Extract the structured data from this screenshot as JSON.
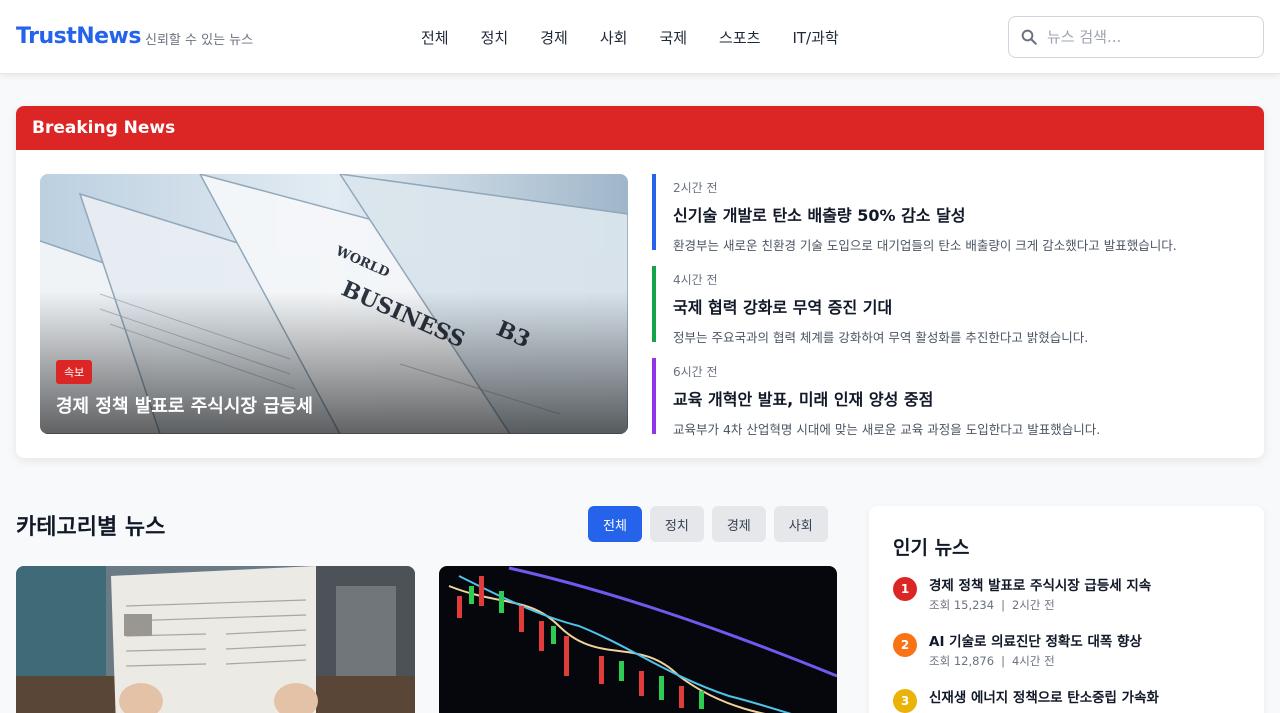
{
  "header": {
    "logo": "TrustNews",
    "tagline": "신뢰할 수 있는 뉴스",
    "nav": [
      "전체",
      "정치",
      "경제",
      "사회",
      "국제",
      "스포츠",
      "IT/과학"
    ],
    "search_placeholder": "뉴스 검색...",
    "search_value": ""
  },
  "breaking": {
    "heading": "Breaking News",
    "hero": {
      "badge": "속보",
      "title": "경제 정책 발표로 주식시장 급등세"
    },
    "items": [
      {
        "time": "2시간 전",
        "title": "신기술 개발로 탄소 배출량 50% 감소 달성",
        "desc": "환경부는 새로운 친환경 기술 도입으로 대기업들의 탄소 배출량이 크게 감소했다고 발표했습니다.",
        "accent": "#2563eb"
      },
      {
        "time": "4시간 전",
        "title": "국제 협력 강화로 무역 증진 기대",
        "desc": "정부는 주요국과의 협력 체계를 강화하여 무역 활성화를 추진한다고 밝혔습니다.",
        "accent": "#16a34a"
      },
      {
        "time": "6시간 전",
        "title": "교육 개혁안 발표, 미래 인재 양성 중점",
        "desc": "교육부가 4차 산업혁명 시대에 맞는 새로운 교육 과정을 도입한다고 발표했습니다.",
        "accent": "#9333ea"
      }
    ]
  },
  "category": {
    "title": "카테고리별 뉴스",
    "filters": [
      "전체",
      "정치",
      "경제",
      "사회"
    ],
    "active_filter": "전체"
  },
  "popular": {
    "title": "인기 뉴스",
    "items": [
      {
        "rank": "1",
        "title": "경제 정책 발표로 주식시장 급등세 지속",
        "views": "조회 15,234",
        "time": "2시간 전",
        "color": "#dc2626"
      },
      {
        "rank": "2",
        "title": "AI 기술로 의료진단 정확도 대폭 향상",
        "views": "조회 12,876",
        "time": "4시간 전",
        "color": "#f97316"
      },
      {
        "rank": "3",
        "title": "신재생 에너지 정책으로 탄소중립 가속화",
        "views": "",
        "time": "",
        "color": "#eab308"
      }
    ]
  },
  "colors": {
    "brand": "#2563eb",
    "breaking": "#dc2626",
    "page_bg": "#f8f9fb"
  },
  "icons": {
    "search": "search-icon"
  }
}
